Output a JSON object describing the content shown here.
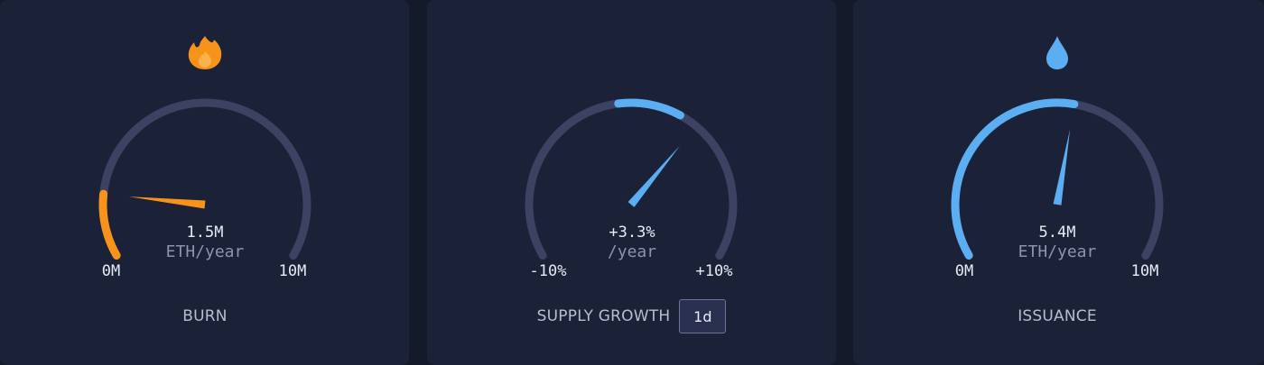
{
  "colors": {
    "track": "#3e4262",
    "burn": "#f7931a",
    "supply": "#5caef3",
    "issuance": "#5caef3"
  },
  "burn": {
    "icon": "fire-icon",
    "value": "1.5M",
    "unit": "ETH/year",
    "min_label": "0M",
    "max_label": "10M",
    "title": "BURN",
    "level": 0.15
  },
  "supply_growth": {
    "value": "+3.3%",
    "unit": "/year",
    "min_label": "-10%",
    "max_label": "+10%",
    "title": "SUPPLY GROWTH",
    "period": "1d",
    "level": 0.665
  },
  "issuance": {
    "icon": "droplet-icon",
    "value": "5.4M",
    "unit": "ETH/year",
    "min_label": "0M",
    "max_label": "10M",
    "title": "ISSUANCE",
    "level": 0.54
  }
}
